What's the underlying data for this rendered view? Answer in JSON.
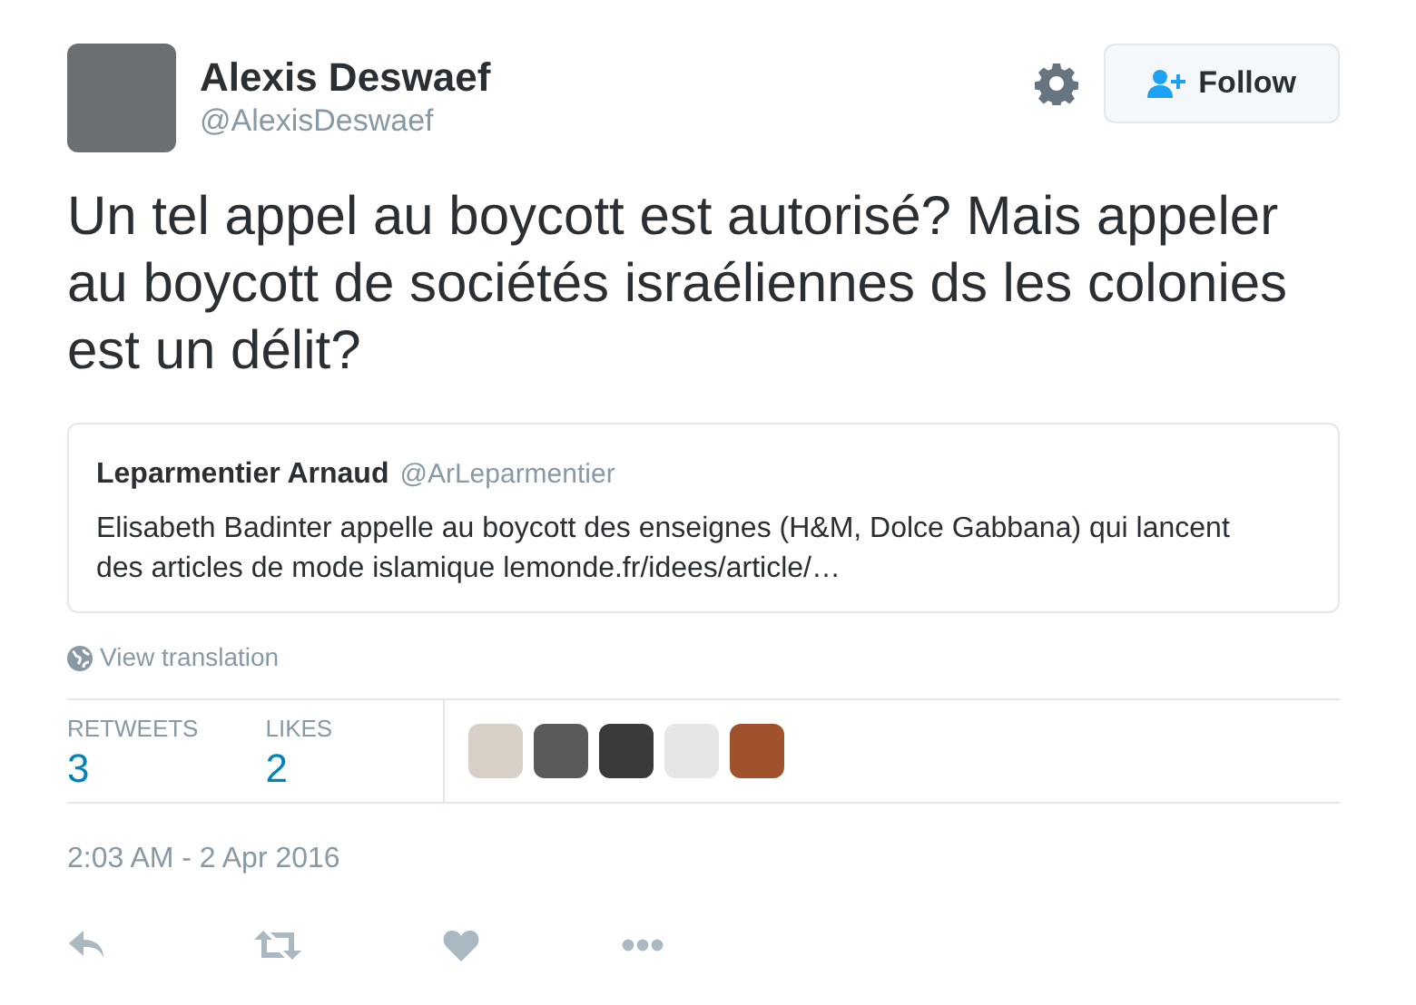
{
  "author": {
    "name": "Alexis Deswaef",
    "handle": "@AlexisDeswaef"
  },
  "follow_button": {
    "label": "Follow"
  },
  "tweet_text": "Un tel appel au boycott est autorisé? Mais appeler au boycott de sociétés israéliennes ds les colonies est un délit?",
  "quoted_tweet": {
    "name": "Leparmentier Arnaud",
    "handle": "@ArLeparmentier",
    "text": "Elisabeth Badinter appelle au boycott des enseignes (H&M, Dolce Gabbana) qui lancent des articles de mode islamique lemonde.fr/idees/article/…"
  },
  "view_translation": "View translation",
  "stats": [
    {
      "label": "RETWEETS",
      "value": "3"
    },
    {
      "label": "LIKES",
      "value": "2"
    }
  ],
  "timestamp": "2:03 AM - 2 Apr 2016"
}
